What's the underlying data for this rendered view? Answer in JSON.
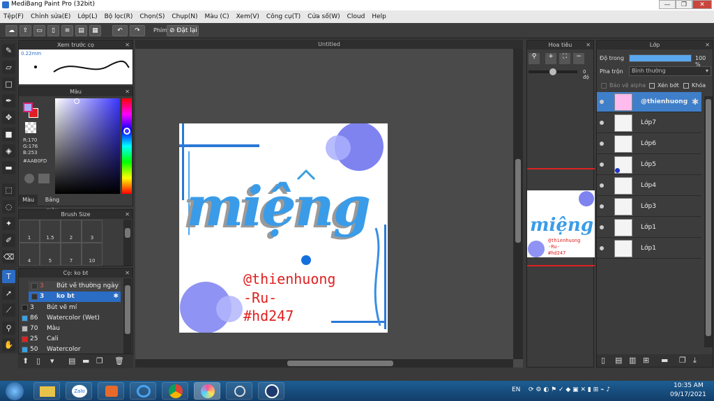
{
  "window": {
    "title": "MediBang Paint Pro (32bit)"
  },
  "menu": [
    "Tệp(F)",
    "Chỉnh sửa(E)",
    "Lớp(L)",
    "Bộ lọc(R)",
    "Chọn(S)",
    "Chụp(N)",
    "Màu (C)",
    "Xem(V)",
    "Công cụ(T)",
    "Cửa số(W)",
    "Cloud",
    "Help"
  ],
  "toolbar": {
    "snap_label": "Phím",
    "reset_label": "Đặt lại"
  },
  "brush_preview": {
    "title": "Xem trước cọ",
    "size": "0.22mm"
  },
  "color_panel": {
    "title": "Màu",
    "r": "R:170",
    "g": "G:176",
    "b": "B:253",
    "hex": "#AAB0FD",
    "tab_color": "Màu",
    "tab_palette": "Bảng màu",
    "fg": "#aab0fd",
    "bg": "#e02020"
  },
  "brush_size": {
    "title": "Brush Size",
    "sizes": [
      "1",
      "1.5",
      "2",
      "3",
      "4",
      "5",
      "7",
      "10"
    ]
  },
  "brush_list": {
    "title": "Cọ: ko bt",
    "items": [
      {
        "num": "3",
        "label": "Bút vẽ thường ngày",
        "color": "#333333"
      },
      {
        "num": "3",
        "label": "ko bt",
        "color": "#333333"
      },
      {
        "num": "3",
        "label": "Bút vẽ mí",
        "color": "#222222"
      },
      {
        "num": "86",
        "label": "Watercolor (Wet)",
        "color": "#3aa0e0"
      },
      {
        "num": "70",
        "label": "Màu",
        "color": "#bbbbbb"
      },
      {
        "num": "25",
        "label": "Cali",
        "color": "#e02020"
      },
      {
        "num": "50",
        "label": "Watercolor",
        "color": "#3aa0e0"
      }
    ]
  },
  "canvas": {
    "tab_title": "Untitled",
    "lettering": "miệng",
    "handle": "@thienhuong",
    "tag1": "-Ru-",
    "tag2": "#hd247"
  },
  "navigator": {
    "title": "Hoa tiêu",
    "angle": "0 độ"
  },
  "layers": {
    "title": "Lớp",
    "opacity_label": "Độ trong",
    "opacity_value": "100 %",
    "opacity_fraction": 1.0,
    "blend_label": "Pha trộn",
    "blend_value": "Bình thường",
    "protect_alpha": "Bảo vệ alpha",
    "clipping": "Xén bớt",
    "lock": "Khóa",
    "rows": [
      {
        "name": "@thienhuong",
        "selected": true
      },
      {
        "name": "Lớp7",
        "selected": false
      },
      {
        "name": "Lớp6",
        "selected": false
      },
      {
        "name": "Lớp5",
        "selected": false
      },
      {
        "name": "Lớp4",
        "selected": false
      },
      {
        "name": "Lớp3",
        "selected": false
      },
      {
        "name": "Lớp1",
        "selected": false
      },
      {
        "name": "Lớp1",
        "selected": false
      }
    ]
  },
  "taskbar": {
    "lang": "EN",
    "time": "10:35 AM",
    "date": "09/17/2021",
    "zalo": "Zalo"
  }
}
